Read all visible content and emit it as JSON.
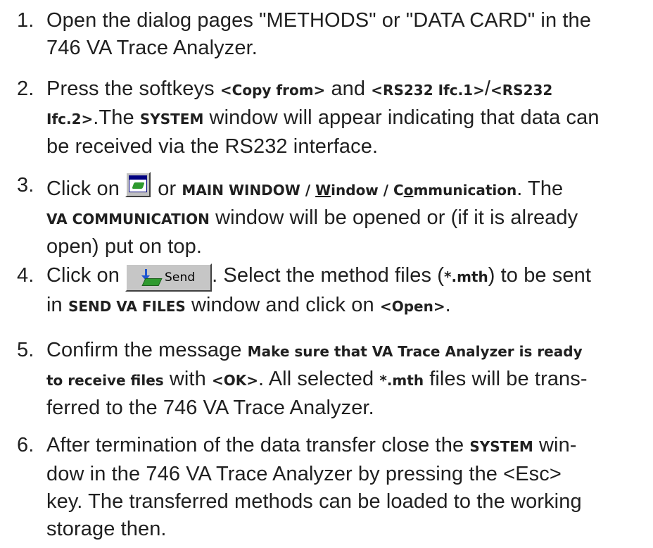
{
  "steps": [
    {
      "number": "1.",
      "line1": "Open the dialog pages \"METHODS\" or \"DATA CARD\" in the",
      "line2": "746 VA Trace Analyzer."
    },
    {
      "number": "2.",
      "t1": "Press the softkeys ",
      "b1": "<Copy from>",
      "t2": " and ",
      "b2": "<RS232 Ifc.1>",
      "t3": "/",
      "b3": "<RS232",
      "b4": "Ifc.2>",
      "t4": ".The ",
      "b5": "SYSTEM",
      "t5": " window will appear indicating that data can",
      "t6": "be received via the RS232 interface."
    },
    {
      "number": "3.",
      "icon": "window-icon",
      "t1": "Click on ",
      "t2": " or ",
      "b1": "MAIN WINDOW / ",
      "b1u": "W",
      "b2": "indow / C",
      "b2u": "o",
      "b3": "mmunication",
      "t3": ". The",
      "b4": "VA COMMUNICATION",
      "t4": " window will be opened or (if it is already",
      "t5": "open) put on top."
    },
    {
      "number": "4.",
      "t1": "Click on ",
      "button_label": "Send",
      "button_icon": "send-tray-icon",
      "t2": ". Select the method files (",
      "b1": "*.mth",
      "t3": ") to be sent",
      "t4": "in ",
      "b2": "SEND VA FILES",
      "t5": " window and click on ",
      "b3": "<Open>",
      "t6": "."
    },
    {
      "number": "5.",
      "t1": "Confirm the message ",
      "b1": "Make sure that VA Trace Analyzer is ready",
      "b2": "to receive files",
      "t2": " with ",
      "b3": "<OK>",
      "t3": ". All selected ",
      "b4": "*.mth",
      "t4": " files will be trans-",
      "t5": "ferred to the 746 VA Trace Analyzer."
    },
    {
      "number": "6.",
      "t1": "After termination of the data transfer close the ",
      "b1": "SYSTEM",
      "t2": " win-",
      "t3": "dow in the 746 VA Trace Analyzer by pressing the <Esc>",
      "t4": "key. The transferred methods can be loaded to the working",
      "t5": "storage then."
    }
  ]
}
